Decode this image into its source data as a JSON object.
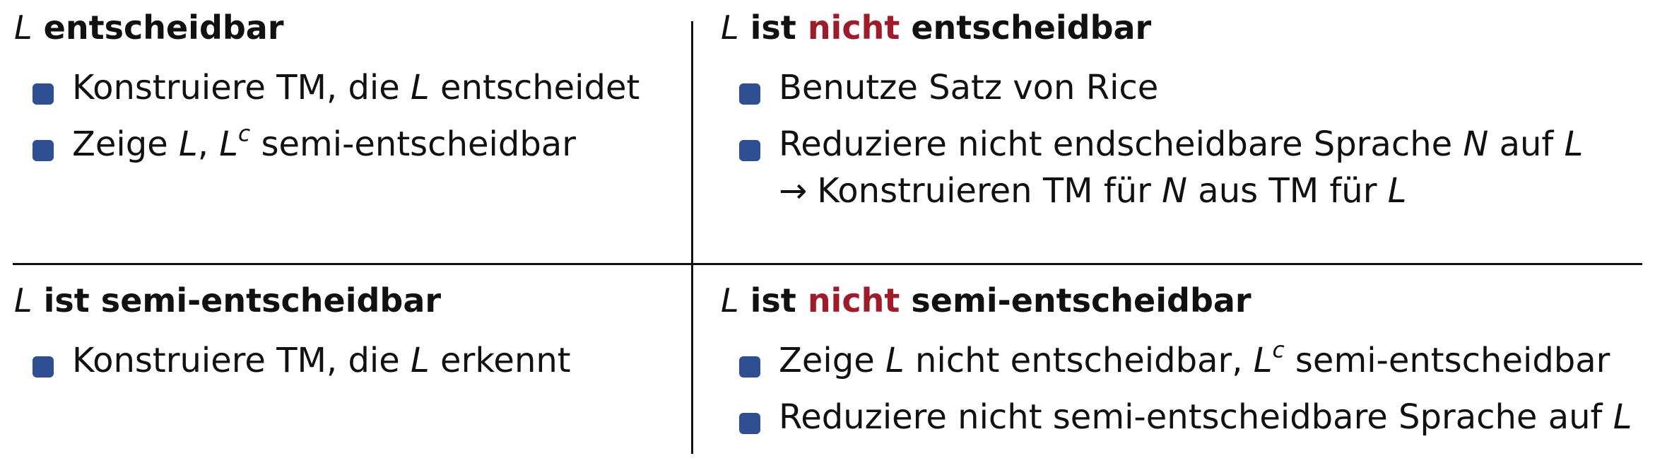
{
  "top_left": {
    "heading": {
      "var": "L",
      "text": "entscheidbar"
    },
    "items": [
      {
        "before": "Konstruiere TM, die ",
        "var": "L",
        "after": " entscheidet"
      },
      {
        "before": "Zeige ",
        "var1": "L",
        "sep": ", ",
        "var2": "L",
        "sup": "c",
        "after": " semi-entscheidbar"
      }
    ]
  },
  "top_right": {
    "heading": {
      "var": "L",
      "pre": "ist",
      "neg": "nicht",
      "text": "entscheidbar"
    },
    "items": [
      {
        "text": "Benutze Satz von Rice"
      },
      {
        "before": "Reduziere nicht endscheidbare Sprache ",
        "var1": "N",
        "mid": " auf ",
        "var2": "L",
        "cont_arrow": "→",
        "cont_before": "Konstruieren TM für ",
        "cont_var1": "N",
        "cont_mid": " aus TM für ",
        "cont_var2": "L"
      }
    ]
  },
  "bottom_left": {
    "heading": {
      "var": "L",
      "text": "ist semi-entscheidbar"
    },
    "items": [
      {
        "before": "Konstruiere TM, die ",
        "var": "L",
        "after": " erkennt"
      }
    ]
  },
  "bottom_right": {
    "heading": {
      "var": "L",
      "pre": "ist",
      "neg": "nicht",
      "text": "semi-entscheidbar"
    },
    "items": [
      {
        "before": "Zeige ",
        "var1": "L",
        "mid": " nicht entscheidbar, ",
        "var2": "L",
        "sup": "c",
        "after": " semi-entscheidbar"
      },
      {
        "before": "Reduziere nicht semi-entscheidbare Sprache auf ",
        "var": "L"
      }
    ]
  },
  "colors": {
    "negation": "#a11a2a",
    "bullet": "#2f4f94",
    "text": "#111111"
  }
}
